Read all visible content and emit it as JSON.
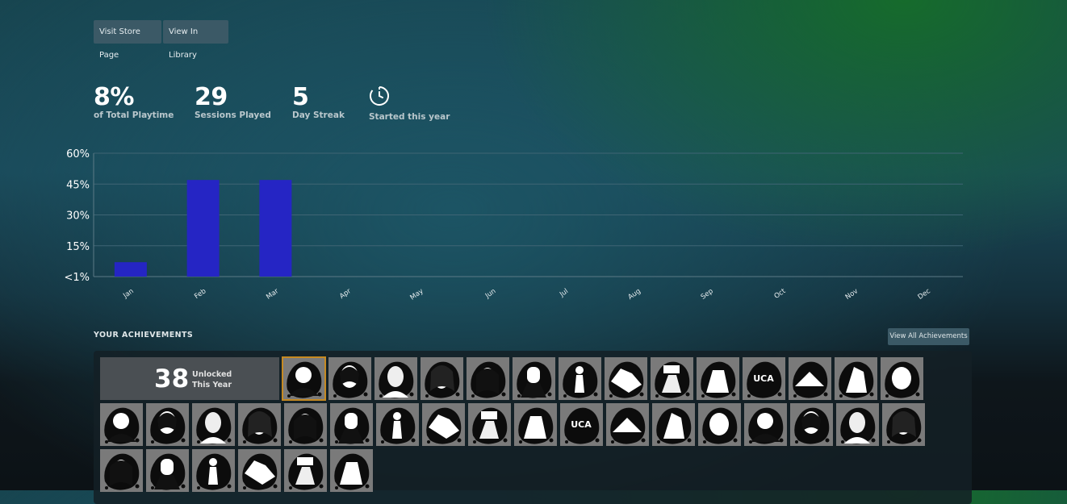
{
  "header": {
    "store_button": "Visit Store Page",
    "library_button": "View In Library"
  },
  "stats": {
    "playtime_value": "8%",
    "playtime_label": "of Total Playtime",
    "sessions_value": "29",
    "sessions_label": "Sessions Played",
    "streak_value": "5",
    "streak_label": "Day Streak",
    "started_label": "Started this year",
    "started_icon": "clock-icon"
  },
  "chart_data": {
    "type": "bar",
    "categories": [
      "Jan",
      "Feb",
      "Mar",
      "Apr",
      "May",
      "Jun",
      "Jul",
      "Aug",
      "Sep",
      "Oct",
      "Nov",
      "Dec"
    ],
    "values": [
      7,
      47,
      47,
      0,
      0,
      0,
      0,
      0,
      0,
      0,
      0,
      0
    ],
    "yticks": [
      "<1%",
      "15%",
      "30%",
      "45%",
      "60%"
    ],
    "ylim": [
      0,
      60
    ],
    "grid": true,
    "bar_color": "#2525c4"
  },
  "achievements": {
    "title": "YOUR ACHIEVEMENTS",
    "view_all": "View All Achievements",
    "unlocked_count": "38",
    "unlocked_line1": "Unlocked",
    "unlocked_line2": "This Year",
    "icon_count": 38,
    "selected_index": 0,
    "tile_color": "#7a7a7a",
    "highlight_color": "#c68a22"
  }
}
